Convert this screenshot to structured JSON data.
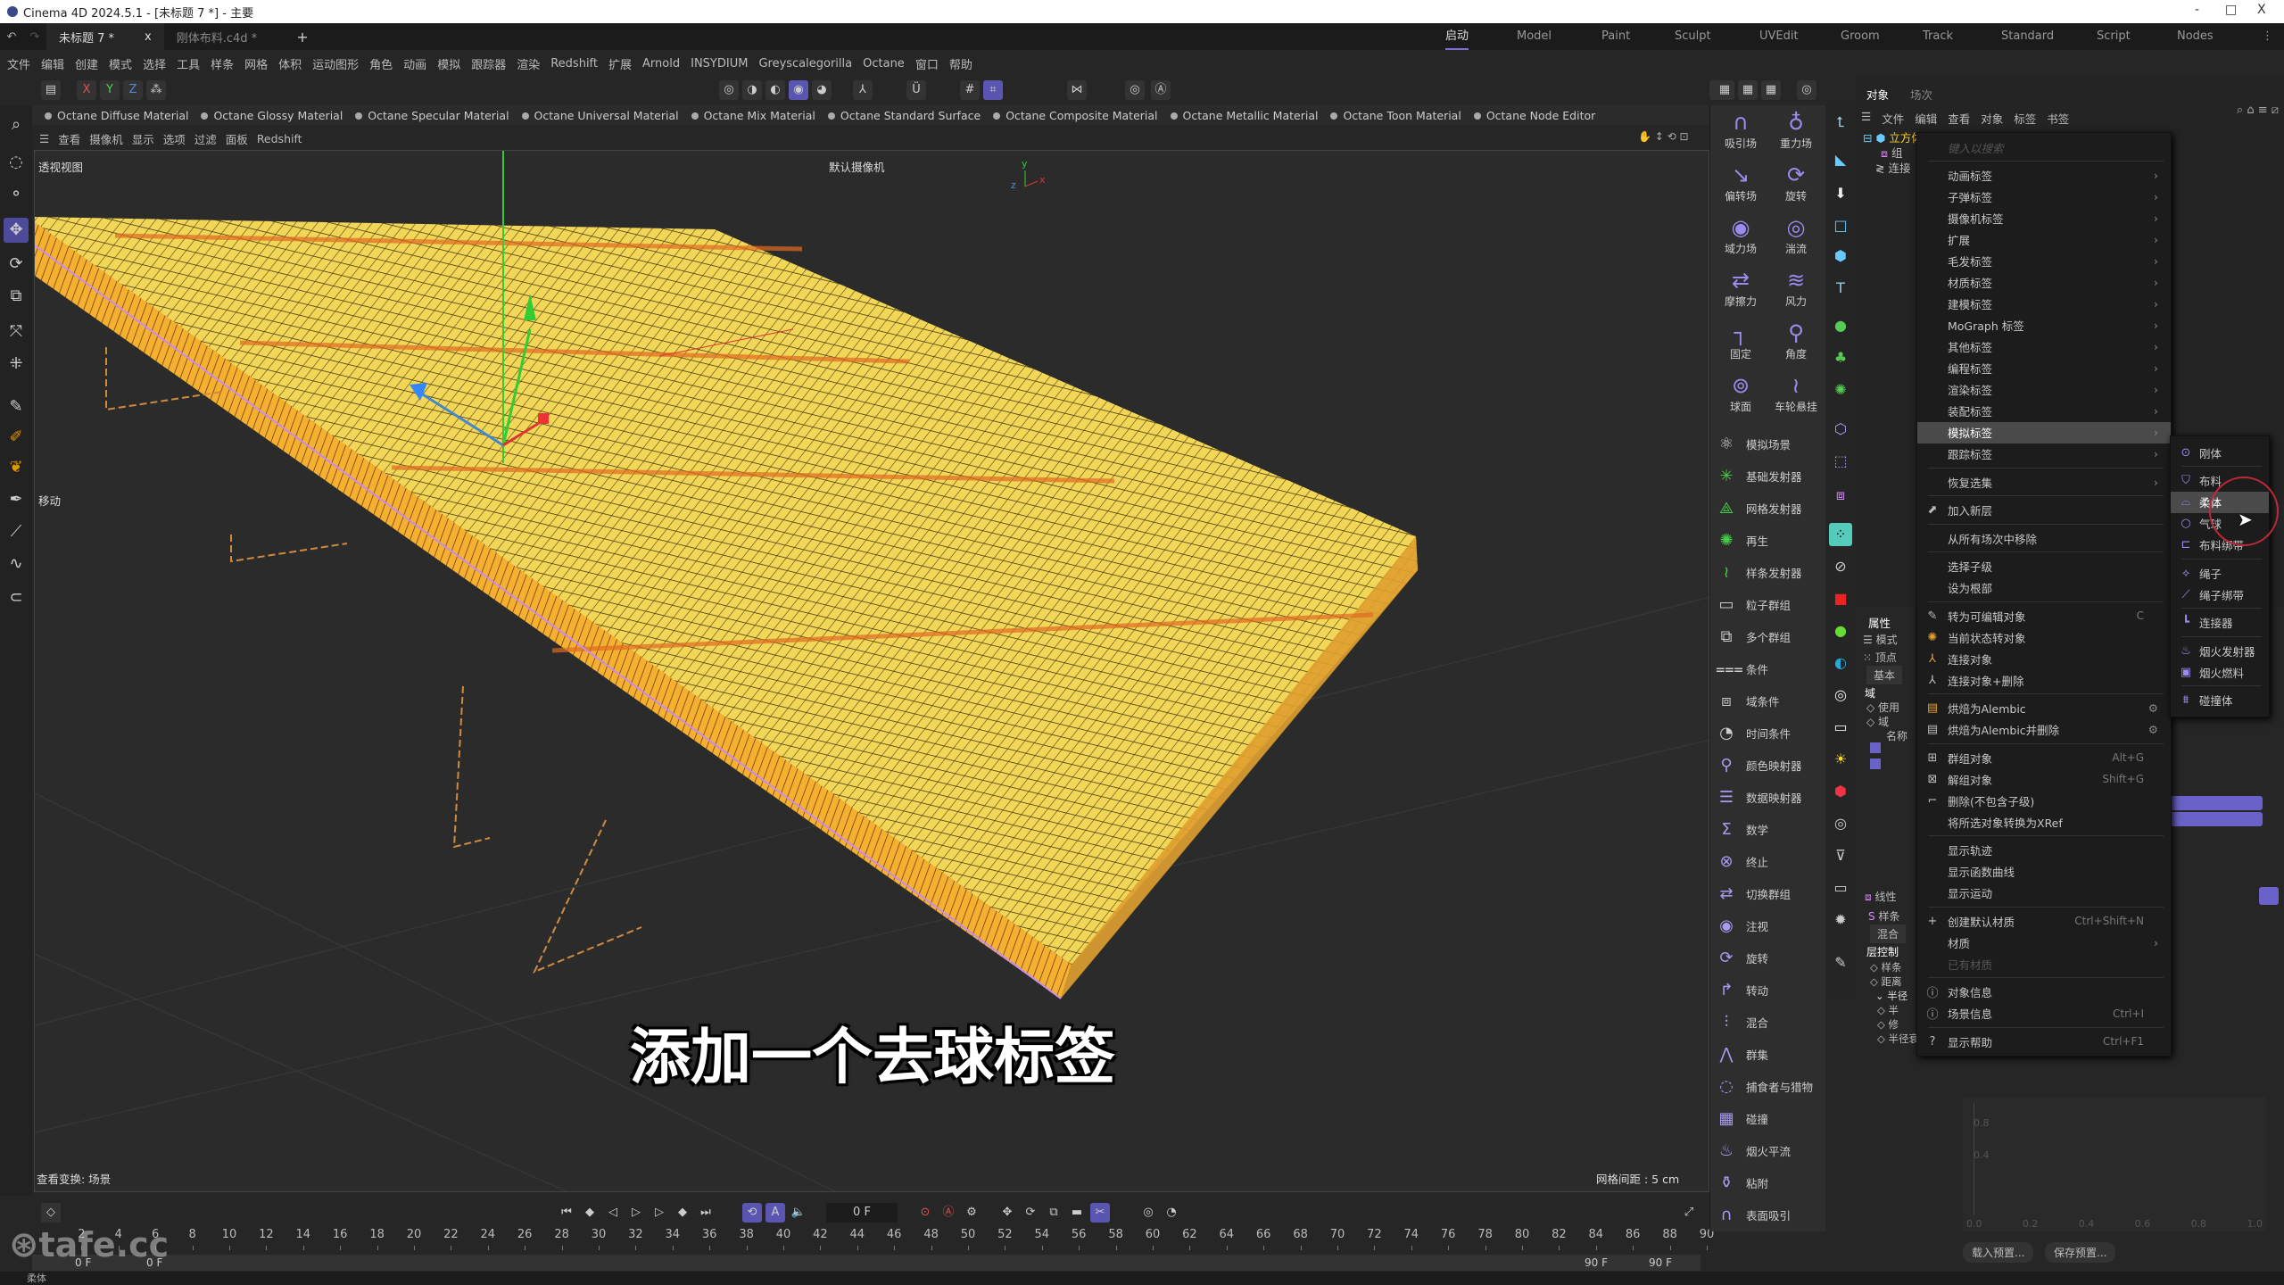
{
  "window": {
    "title": "Cinema 4D 2024.5.1 - [未标题 7 *] - 主要",
    "controls": [
      "-",
      "□",
      "X"
    ]
  },
  "doc_tabs": [
    {
      "label": "未标题 7 *",
      "active": true
    },
    {
      "label": "刚体布料.c4d *",
      "active": false
    }
  ],
  "layout_tabs": [
    {
      "label": "启动",
      "active": true
    },
    {
      "label": "Model"
    },
    {
      "label": "Paint"
    },
    {
      "label": "Sculpt"
    },
    {
      "label": "UVEdit"
    },
    {
      "label": "Groom"
    },
    {
      "label": "Track"
    },
    {
      "label": "Standard"
    },
    {
      "label": "Script"
    },
    {
      "label": "Nodes"
    }
  ],
  "menubar": [
    "文件",
    "编辑",
    "创建",
    "模式",
    "选择",
    "工具",
    "样条",
    "网格",
    "体积",
    "运动图形",
    "角色",
    "动画",
    "模拟",
    "跟踪器",
    "渲染",
    "Redshift",
    "扩展",
    "Arnold",
    "INSYDIUM",
    "Greyscalegorilla",
    "Octane",
    "窗口",
    "帮助"
  ],
  "axis_toggles": [
    "X",
    "Y",
    "Z"
  ],
  "octane_materials": [
    "Octane Diffuse Material",
    "Octane Glossy Material",
    "Octane Specular Material",
    "Octane Universal Material",
    "Octane Mix Material",
    "Octane Standard Surface",
    "Octane Composite Material",
    "Octane Metallic Material",
    "Octane Toon Material",
    "Octane Node Editor"
  ],
  "viewport_menu": [
    "查看",
    "摄像机",
    "显示",
    "选项",
    "过滤",
    "面板",
    "Redshift"
  ],
  "viewport": {
    "view_name": "透视视图",
    "camera": "默认摄像机",
    "tool": "移动",
    "transform": "查看变换: 场景",
    "grid_spacing": "网格间距 : 5 cm",
    "subtitle": "添加一个去球标签"
  },
  "timeline": {
    "current_frame": "0 F",
    "start": "0 F",
    "start2": "0 F",
    "end": "90 F",
    "end2": "90 F",
    "ticks": [
      2,
      4,
      6,
      8,
      10,
      12,
      14,
      16,
      18,
      20,
      22,
      24,
      26,
      28,
      30,
      32,
      34,
      36,
      38,
      40,
      42,
      44,
      46,
      48,
      50,
      52,
      54,
      56,
      58,
      60,
      62,
      64,
      66,
      68,
      70,
      72,
      74,
      76,
      78,
      80,
      82,
      84,
      86,
      88,
      90
    ]
  },
  "status": "柔体",
  "watermark": "tafe.cc",
  "sim_palette": {
    "grid": [
      {
        "label": "吸引场",
        "icon": "magnet-icon"
      },
      {
        "label": "重力场",
        "icon": "gravity-icon"
      },
      {
        "label": "偏转场",
        "icon": "deflector-icon"
      },
      {
        "label": "旋转",
        "icon": "rotation-icon"
      },
      {
        "label": "域力场",
        "icon": "field-force-icon"
      },
      {
        "label": "湍流",
        "icon": "turbulence-icon"
      },
      {
        "label": "摩擦力",
        "icon": "friction-icon"
      },
      {
        "label": "风力",
        "icon": "wind-icon"
      },
      {
        "label": "固定",
        "icon": "fixed-icon"
      },
      {
        "label": "角度",
        "icon": "angle-icon"
      },
      {
        "label": "球面",
        "icon": "spherical-icon"
      },
      {
        "label": "车轮悬挂",
        "icon": "wheel-suspension-icon"
      }
    ],
    "list": [
      "模拟场景",
      "基础发射器",
      "网格发射器",
      "再生",
      "样条发射器",
      "粒子群组",
      "多个群组",
      "条件",
      "域条件",
      "时间条件",
      "颜色映射器",
      "数据映射器",
      "数学",
      "终止",
      "切换群组",
      "注视",
      "旋转",
      "转动",
      "混合",
      "群集",
      "捕食者与猎物",
      "碰撞",
      "烟火平流",
      "粘附",
      "表面吸引"
    ]
  },
  "object_manager": {
    "tabs": [
      "对象",
      "场次"
    ],
    "menu": [
      "文件",
      "编辑",
      "查看",
      "对象",
      "标签",
      "书签"
    ],
    "tree": [
      "立方体",
      "组",
      "连接"
    ]
  },
  "attributes": {
    "tab": "属性",
    "mode": "模式",
    "vertex": "顶点",
    "basic": "基本",
    "field": "域",
    "use": "使用",
    "field2": "域",
    "name": "名称",
    "linear": "线性",
    "spline": "样条",
    "blend": "混合",
    "layer_control": "层控制",
    "items": [
      "样条",
      "距离",
      "半径",
      "半",
      "修",
      "半径衰减"
    ],
    "graph_y": [
      "0.8",
      "0.4"
    ],
    "graph_x": [
      "0.0",
      "0.2",
      "0.4",
      "0.6",
      "0.8",
      "1.0"
    ],
    "load_preset": "载入预置...",
    "save_preset": "保存预置..."
  },
  "context_menu": {
    "search_placeholder": "键入以搜索",
    "groups": [
      [
        {
          "label": "动画标签",
          "sub": true
        },
        {
          "label": "子弹标签",
          "sub": true
        },
        {
          "label": "摄像机标签",
          "sub": true
        },
        {
          "label": "扩展",
          "sub": true
        },
        {
          "label": "毛发标签",
          "sub": true
        },
        {
          "label": "材质标签",
          "sub": true
        },
        {
          "label": "建模标签",
          "sub": true
        },
        {
          "label": "MoGraph 标签",
          "sub": true
        },
        {
          "label": "其他标签",
          "sub": true
        },
        {
          "label": "编程标签",
          "sub": true
        },
        {
          "label": "渲染标签",
          "sub": true
        },
        {
          "label": "装配标签",
          "sub": true
        },
        {
          "label": "模拟标签",
          "sub": true,
          "highlight": true
        },
        {
          "label": "跟踪标签",
          "sub": true
        }
      ],
      [
        {
          "label": "恢复选集",
          "sub": true
        }
      ],
      [
        {
          "label": "加入新层",
          "icon": "layer-icon"
        }
      ],
      [
        {
          "label": "从所有场次中移除"
        }
      ],
      [
        {
          "label": "选择子级"
        },
        {
          "label": "设为根部"
        }
      ],
      [
        {
          "label": "转为可编辑对象",
          "icon": "edit-icon",
          "shortcut": "C"
        },
        {
          "label": "当前状态转对象",
          "icon": "state-icon"
        },
        {
          "label": "连接对象",
          "icon": "connect-icon"
        },
        {
          "label": "连接对象+删除",
          "icon": "connect-delete-icon"
        }
      ],
      [
        {
          "label": "烘焙为Alembic",
          "icon": "alembic-icon",
          "gear": true
        },
        {
          "label": "烘焙为Alembic并删除",
          "icon": "alembic-delete-icon",
          "gear": true
        }
      ],
      [
        {
          "label": "群组对象",
          "icon": "group-icon",
          "shortcut": "Alt+G"
        },
        {
          "label": "解组对象",
          "icon": "ungroup-icon",
          "shortcut": "Shift+G"
        },
        {
          "label": "删除(不包含子级)",
          "icon": "delete-icon"
        },
        {
          "label": "将所选对象转换为XRef"
        }
      ],
      [
        {
          "label": "显示轨迹"
        },
        {
          "label": "显示函数曲线"
        },
        {
          "label": "显示运动"
        }
      ],
      [
        {
          "label": "创建默认材质",
          "icon": "plus-icon",
          "shortcut": "Ctrl+Shift+N"
        },
        {
          "label": "材质",
          "sub": true
        },
        {
          "label": "已有材质",
          "disabled": true
        }
      ],
      [
        {
          "label": "对象信息",
          "icon": "info-icon"
        },
        {
          "label": "场景信息",
          "icon": "info-icon",
          "shortcut": "Ctrl+I"
        }
      ],
      [
        {
          "label": "显示帮助",
          "icon": "help-icon",
          "shortcut": "Ctrl+F1"
        }
      ]
    ]
  },
  "submenu": {
    "groups": [
      [
        {
          "label": "刚体",
          "icon": "rigid-body-icon"
        }
      ],
      [
        {
          "label": "布料",
          "icon": "cloth-icon"
        },
        {
          "label": "柔体",
          "icon": "soft-body-icon",
          "highlight": true
        },
        {
          "label": "气球",
          "icon": "balloon-icon"
        },
        {
          "label": "布料绑带",
          "icon": "cloth-belt-icon"
        }
      ],
      [
        {
          "label": "绳子",
          "icon": "rope-icon"
        },
        {
          "label": "绳子绑带",
          "icon": "rope-belt-icon"
        }
      ],
      [
        {
          "label": "连接器",
          "icon": "connector-icon"
        }
      ],
      [
        {
          "label": "烟火发射器",
          "icon": "pyro-emitter-icon"
        },
        {
          "label": "烟火燃料",
          "icon": "pyro-fuel-icon"
        }
      ],
      [
        {
          "label": "碰撞体",
          "icon": "collider-icon"
        }
      ]
    ]
  },
  "colors": {
    "accent": "#5a55b0",
    "mesh": "#f0d050",
    "highlight_ring": "#c0283a"
  }
}
